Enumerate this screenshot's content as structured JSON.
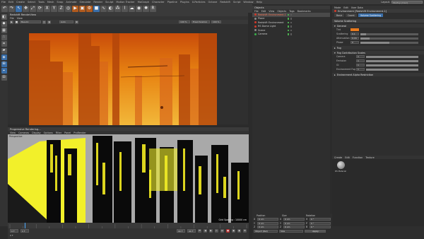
{
  "menu": [
    "File",
    "Edit",
    "Create",
    "Select",
    "Tools",
    "Mesh",
    "Snap",
    "Animate",
    "Simulate",
    "Render",
    "Sculpt",
    "Motion Tracker",
    "MoGraph",
    "Character",
    "Pipeline",
    "Plugins",
    "X-Particles",
    "Octane",
    "Redshift",
    "Script",
    "Window",
    "Help"
  ],
  "layout": {
    "label": "Layout:",
    "value": "Startup (User)"
  },
  "toolbar": {
    "undo": "↶",
    "redo": "↷",
    "select": "↖",
    "move": "✥",
    "scale": "⤢",
    "rotate": "⟳",
    "x": "X",
    "y": "Y",
    "z": "Z",
    "world": "◎"
  },
  "renderview": {
    "title": "Redshift RenderView",
    "menu": [
      "File",
      "View"
    ],
    "ctrl": {
      "display": "Beauty",
      "mode": "Auto",
      "percent": "100 %",
      "fit": "Fit",
      "snapshot": "Snapshot",
      "render": "Render",
      "zoom_value": "100 %",
      "exposure": "Fixed Scaling"
    }
  },
  "bottomview": {
    "title": "Progressive Rendering...",
    "menu": [
      "View",
      "Cameras",
      "Display",
      "Options",
      "Filter",
      "Panel",
      "ProRender"
    ],
    "camera": "Perspective",
    "status": "Grid Spacing : 10000 cm"
  },
  "timeline": {
    "start": "0 F",
    "current": "0 F",
    "end": "90 F",
    "end2": "90 F",
    "frame_label": "0 F"
  },
  "objects": {
    "title": "Objects",
    "menu": [
      "File",
      "Edit",
      "View",
      "Objects",
      "Tags",
      "Bookmarks"
    ],
    "items": [
      {
        "name": "Redshift Environment.1",
        "type": "rs"
      },
      {
        "name": "Plane",
        "type": "obj"
      },
      {
        "name": "Redshift Environment",
        "type": "rs"
      },
      {
        "name": "RS Dome Light",
        "type": "rs"
      },
      {
        "name": "Scene",
        "type": "obj"
      },
      {
        "name": "Camera",
        "type": "cam"
      }
    ]
  },
  "attributes": {
    "header": [
      "Mode",
      "Edit",
      "User Data"
    ],
    "object_title": "Environment [Redshift Environment.1]",
    "tabs": [
      "Basic",
      "Coord.",
      "Volume Scattering"
    ],
    "active_tab": "Volume Scattering",
    "section_main": "Volume Scattering",
    "section_general": "General",
    "params": [
      {
        "label": "Tint",
        "value": "",
        "fill": 0.0,
        "swatch": "#e87a1e"
      },
      {
        "label": "Scattering",
        "value": "0.1",
        "fill": 0.1
      },
      {
        "label": "Attenuation",
        "value": "0.16",
        "fill": 0.16
      },
      {
        "label": "Phase",
        "value": "0",
        "fill": 0.5
      }
    ],
    "section_fog": "Fog",
    "section_fog_mult": "Fog Contribution Scales",
    "fog_params": [
      {
        "label": "Camera",
        "value": "1"
      },
      {
        "label": "Emission",
        "value": "1"
      },
      {
        "label": "GI",
        "value": "1"
      },
      {
        "label": "Environment Fog",
        "value": "1"
      }
    ],
    "section_alpha": "Environment Alpha Restriction"
  },
  "materials": {
    "menu": [
      "Create",
      "Edit",
      "Function",
      "Texture"
    ],
    "item": "RS Material"
  },
  "coords": {
    "headers": [
      "Position",
      "Size",
      "Rotation"
    ],
    "rows": [
      {
        "axis": "X",
        "pos": "0 cm",
        "size": "0 cm",
        "rlabel": "H",
        "rot": "0 °"
      },
      {
        "axis": "Y",
        "pos": "0 cm",
        "size": "0 cm",
        "rlabel": "P",
        "rot": "0 °"
      },
      {
        "axis": "Z",
        "pos": "0 cm",
        "size": "0 cm",
        "rlabel": "B",
        "rot": "0 °"
      }
    ],
    "mode": "Object (Rel)",
    "size_mode": "Size",
    "apply": "Apply"
  }
}
